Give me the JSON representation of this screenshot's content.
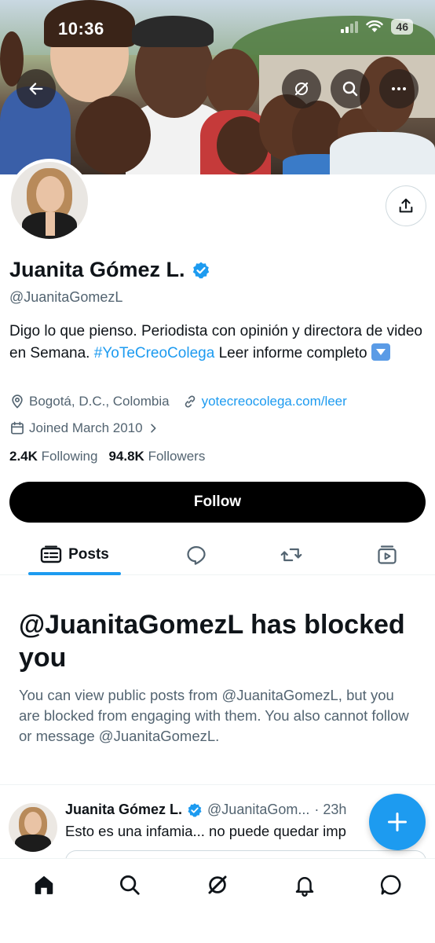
{
  "status_bar": {
    "time": "10:36",
    "battery": "46"
  },
  "profile": {
    "display_name": "Juanita Gómez L.",
    "handle": "@JuanitaGomezL",
    "bio_text": "Digo lo que pienso. Periodista con opinión y directora de video en Semana.",
    "bio_hashtag": "#YoTeCreoColega",
    "bio_suffix": "Leer informe completo",
    "location": "Bogotá, D.C., Colombia",
    "website": "yotecreocolega.com/leer",
    "joined": "Joined March 2010",
    "following_count": "2.4K",
    "following_label": "Following",
    "followers_count": "94.8K",
    "followers_label": "Followers"
  },
  "actions": {
    "follow_label": "Follow"
  },
  "tabs": {
    "posts_label": "Posts"
  },
  "blocked": {
    "title": "@JuanitaGomezL has blocked you",
    "message": "You can view public posts from @JuanitaGomezL, but you are blocked from engaging with them. You also cannot follow or message @JuanitaGomezL."
  },
  "post": {
    "author": "Juanita Gómez L.",
    "handle": "@JuanitaGom...",
    "time": "· 23h",
    "text": "Esto es una infamia... no puede quedar imp"
  },
  "colors": {
    "accent": "#1d9bf0",
    "text": "#0f1419",
    "muted": "#536471"
  }
}
